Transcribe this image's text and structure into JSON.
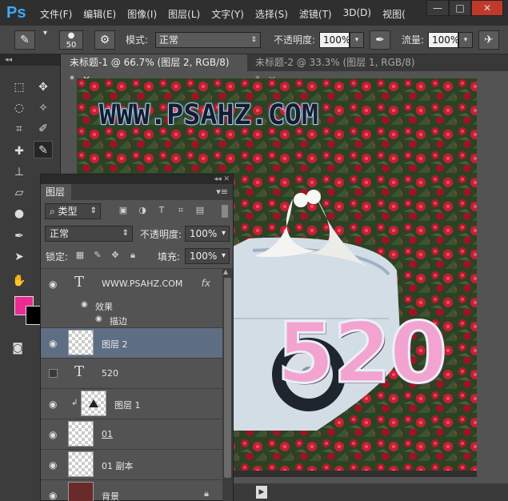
{
  "app": {
    "logo": "Ps"
  },
  "menu": [
    "文件(F)",
    "编辑(E)",
    "图像(I)",
    "图层(L)",
    "文字(Y)",
    "选择(S)",
    "滤镜(T)",
    "3D(D)",
    "视图("
  ],
  "window_controls": {
    "minimize": "—",
    "maximize": "□",
    "close": "✕"
  },
  "options": {
    "brush_size": "50",
    "mode_label": "模式:",
    "mode_value": "正常",
    "opacity_label": "不透明度:",
    "opacity_value": "100%",
    "flow_label": "流量:",
    "flow_value": "100%"
  },
  "tabs": [
    {
      "label": "未标题-1 @ 66.7% (图层 2, RGB/8) *",
      "close": "×"
    },
    {
      "label": "未标题-2 @ 33.3% (图层 1, RGB/8) *",
      "close": "×"
    }
  ],
  "colors": {
    "foreground": "#ec2b92",
    "background": "#000000",
    "selected_layer": "#5e6e83"
  },
  "canvas": {
    "watermark": "WWW.PSAHZ.COM",
    "big_text": "520"
  },
  "layers_panel": {
    "title": "图层",
    "filter_kind": "类型",
    "blend_mode": "正常",
    "opacity_label": "不透明度:",
    "opacity_value": "100%",
    "lock_label": "锁定:",
    "fill_label": "填充:",
    "fill_value": "100%",
    "layers": [
      {
        "name": "WWW.PSAHZ.COM",
        "kind": "text",
        "visible": true,
        "fx": "fx"
      },
      {
        "name": "效果",
        "kind": "effects",
        "visible": true
      },
      {
        "name": "描边",
        "kind": "effect",
        "visible": true
      },
      {
        "name": "图层 2",
        "kind": "pixel",
        "visible": true,
        "selected": true
      },
      {
        "name": "520",
        "kind": "text",
        "visible": false
      },
      {
        "name": "图层 1",
        "kind": "pixel",
        "visible": true
      },
      {
        "name": "01",
        "kind": "pixel",
        "visible": true
      },
      {
        "name": "01 副本",
        "kind": "pixel",
        "visible": true
      },
      {
        "name": "背景",
        "kind": "background",
        "visible": true
      }
    ]
  }
}
